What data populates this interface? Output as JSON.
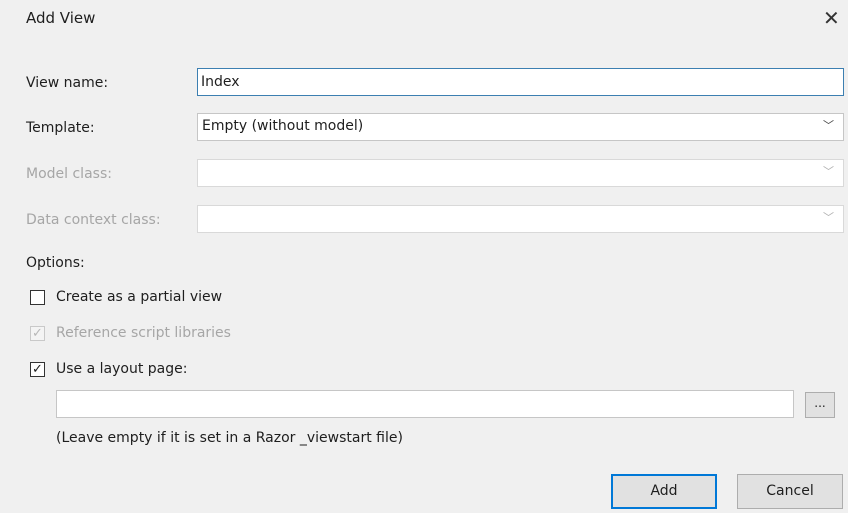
{
  "dialog": {
    "title": "Add View",
    "close_glyph": "✕"
  },
  "form": {
    "view_name_label": "View name:",
    "view_name_value": "Index",
    "template_label": "Template:",
    "template_value": "Empty (without model)",
    "model_class_label": "Model class:",
    "model_class_value": "",
    "data_context_label": "Data context class:",
    "data_context_value": "",
    "chevron_icon": "chevron-down-icon"
  },
  "options": {
    "heading": "Options:",
    "partial_view": {
      "label": "Create as a partial view",
      "checked": false,
      "enabled": true
    },
    "reference_scripts": {
      "label": "Reference script libraries",
      "checked": true,
      "enabled": false
    },
    "use_layout": {
      "label": "Use a layout page:",
      "checked": true,
      "enabled": true
    },
    "layout_path_value": "",
    "browse_label": "...",
    "hint": "(Leave empty if it is set in a Razor _viewstart file)"
  },
  "buttons": {
    "add": "Add",
    "cancel": "Cancel"
  },
  "colors": {
    "focus_border": "#3c7fb1",
    "default_button_border": "#0078d7",
    "disabled_text": "#a6a6a6"
  }
}
